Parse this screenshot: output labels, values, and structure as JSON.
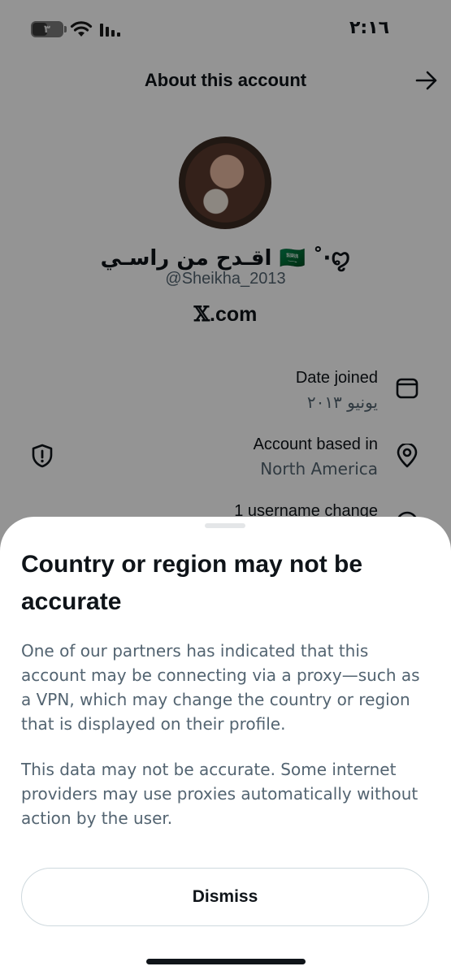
{
  "status_bar": {
    "battery_level": "٣",
    "time": "٢:١٦"
  },
  "header": {
    "title": "About this account",
    "back_icon": "arrow-right-icon"
  },
  "profile": {
    "display_name": "اقـدح من راسـي 🇸🇦 ˚‧ꨄ",
    "handle": "@Sheikha_2013",
    "site_mark": "𝕏",
    "site_suffix": ".com"
  },
  "info": {
    "date_joined_label": "Date joined",
    "date_joined_value": "يونيو ٢٠١٣",
    "based_in_label": "Account based in",
    "based_in_value": "North America",
    "username_change_label": "1 username change"
  },
  "sheet": {
    "title": "Country or region may not be accurate",
    "paragraph1": "One of our partners has indicated that this account may be connecting via a proxy—such as a VPN, which may change the country or region that is displayed on their profile.",
    "paragraph2": "This data may not be accurate. Some internet providers may use proxies automatically without action by the user.",
    "dismiss_label": "Dismiss"
  },
  "colors": {
    "text_primary": "#0f1419",
    "text_secondary": "#536471",
    "overlay": "rgba(0,0,0,0.42)",
    "border": "#cfd9de"
  }
}
